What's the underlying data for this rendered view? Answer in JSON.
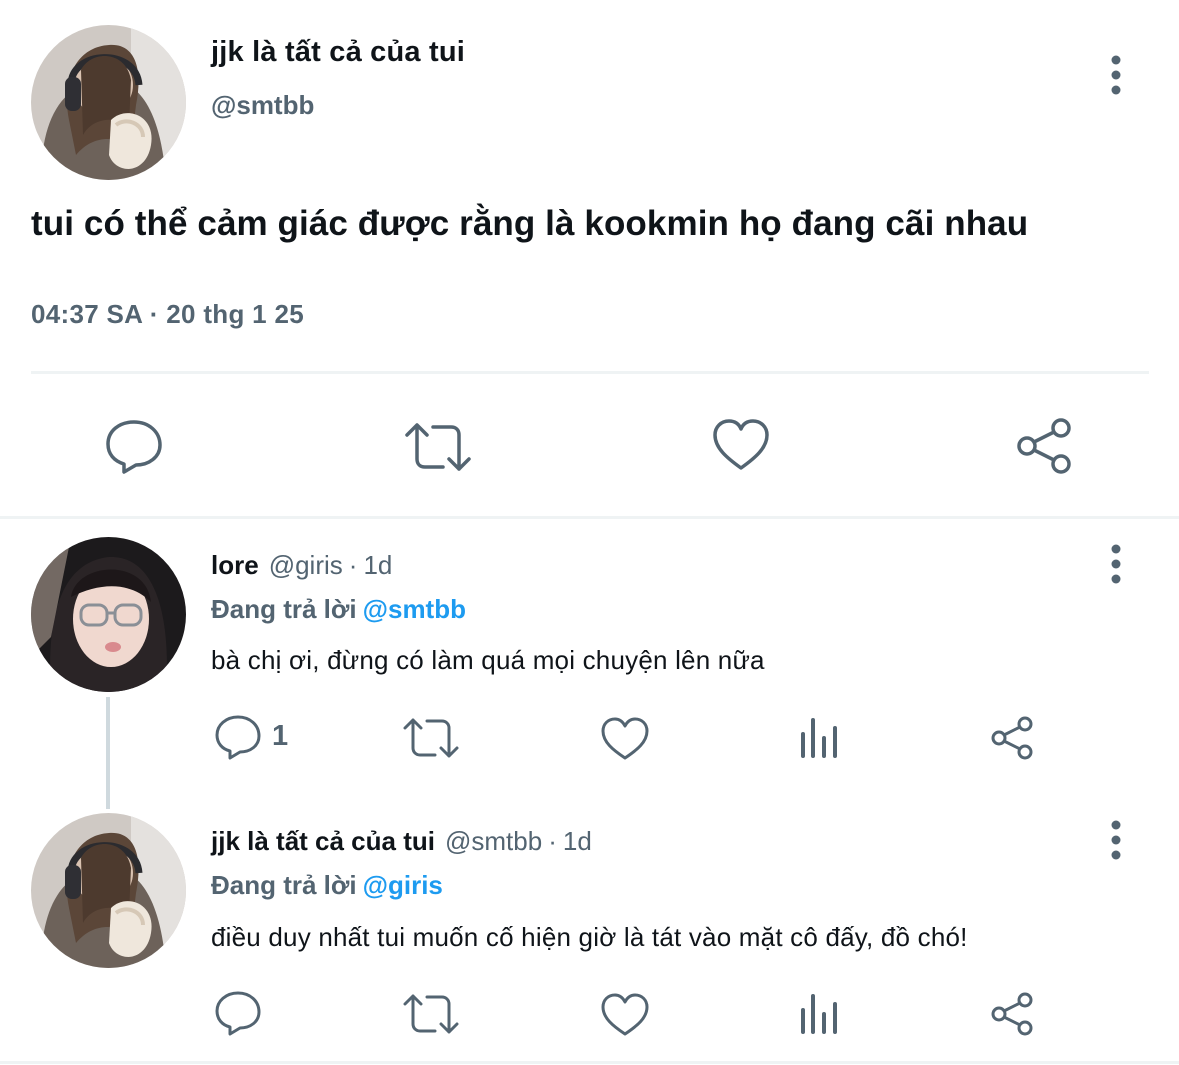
{
  "main_tweet": {
    "display_name": "jjk là tất cả của tui",
    "handle": "@smtbb",
    "text": "tui có thể cảm giác được rằng là kookmin họ đang cãi nhau",
    "timestamp": "04:37 SA · 20 thg 1 25",
    "actions": [
      "reply-icon",
      "retweet-icon",
      "like-icon",
      "share-icon"
    ]
  },
  "replies": [
    {
      "display_name": "lore",
      "handle": "@giris",
      "separator": "·",
      "time": "1d",
      "replying_prefix": "Đang trả lời",
      "replying_to": "@smtbb",
      "text": "bà chị ơi, đừng có làm quá mọi chuyện lên nữa",
      "reply_count": "1"
    },
    {
      "display_name": "jjk là tất cả của tui",
      "handle": "@smtbb",
      "separator": "·",
      "time": "1d",
      "replying_prefix": "Đang trả lời",
      "replying_to": "@giris",
      "text": "điều duy nhất tui muốn cố hiện giờ là tát vào mặt cô đấy, đồ chó!",
      "reply_count": ""
    }
  ],
  "colors": {
    "text_primary": "#0f1419",
    "text_secondary": "#536471",
    "accent": "#1d9bf0",
    "divider": "#eff3f4",
    "thread_line": "#cfd9de"
  }
}
